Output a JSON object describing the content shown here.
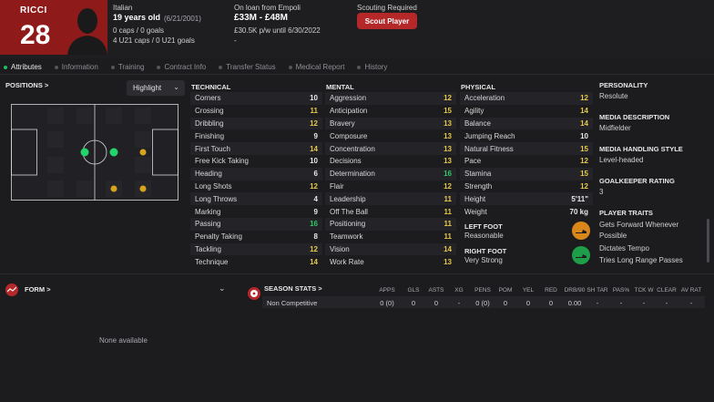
{
  "player": {
    "name": "RICCI",
    "number": "28",
    "nationality": "Italian",
    "age": "19 years old",
    "dob": "(6/21/2001)",
    "caps": "0 caps / 0 goals",
    "u21": "4 U21 caps / 0 U21 goals",
    "loan": "On loan from Empoli",
    "value": "£33M - £48M",
    "wage": "£30.5K p/w until 6/30/2022",
    "dash": "-",
    "scouting": "Scouting Required",
    "scout_button": "Scout Player"
  },
  "tabs": [
    "Attributes",
    "Information",
    "Training",
    "Contract Info",
    "Transfer Status",
    "Medical Report",
    "History"
  ],
  "positions": {
    "title": "POSITIONS >",
    "highlight": "Highlight"
  },
  "technical": {
    "title": "TECHNICAL",
    "rows": [
      {
        "n": "Corners",
        "v": "10",
        "c": ""
      },
      {
        "n": "Crossing",
        "v": "11",
        "c": "y"
      },
      {
        "n": "Dribbling",
        "v": "12",
        "c": "y"
      },
      {
        "n": "Finishing",
        "v": "9",
        "c": ""
      },
      {
        "n": "First Touch",
        "v": "14",
        "c": "y"
      },
      {
        "n": "Free Kick Taking",
        "v": "10",
        "c": ""
      },
      {
        "n": "Heading",
        "v": "6",
        "c": ""
      },
      {
        "n": "Long Shots",
        "v": "12",
        "c": "y"
      },
      {
        "n": "Long Throws",
        "v": "4",
        "c": ""
      },
      {
        "n": "Marking",
        "v": "9",
        "c": ""
      },
      {
        "n": "Passing",
        "v": "16",
        "c": "g"
      },
      {
        "n": "Penalty Taking",
        "v": "8",
        "c": ""
      },
      {
        "n": "Tackling",
        "v": "12",
        "c": "y"
      },
      {
        "n": "Technique",
        "v": "14",
        "c": "y"
      }
    ]
  },
  "mental": {
    "title": "MENTAL",
    "rows": [
      {
        "n": "Aggression",
        "v": "12",
        "c": "y"
      },
      {
        "n": "Anticipation",
        "v": "15",
        "c": "y"
      },
      {
        "n": "Bravery",
        "v": "13",
        "c": "y"
      },
      {
        "n": "Composure",
        "v": "13",
        "c": "y"
      },
      {
        "n": "Concentration",
        "v": "13",
        "c": "y"
      },
      {
        "n": "Decisions",
        "v": "13",
        "c": "y"
      },
      {
        "n": "Determination",
        "v": "16",
        "c": "g"
      },
      {
        "n": "Flair",
        "v": "12",
        "c": "y"
      },
      {
        "n": "Leadership",
        "v": "11",
        "c": "y"
      },
      {
        "n": "Off The Ball",
        "v": "11",
        "c": "y"
      },
      {
        "n": "Positioning",
        "v": "11",
        "c": "y"
      },
      {
        "n": "Teamwork",
        "v": "11",
        "c": "y"
      },
      {
        "n": "Vision",
        "v": "14",
        "c": "y"
      },
      {
        "n": "Work Rate",
        "v": "13",
        "c": "y"
      }
    ]
  },
  "physical": {
    "title": "PHYSICAL",
    "rows": [
      {
        "n": "Acceleration",
        "v": "12",
        "c": "y"
      },
      {
        "n": "Agility",
        "v": "14",
        "c": "y"
      },
      {
        "n": "Balance",
        "v": "14",
        "c": "y"
      },
      {
        "n": "Jumping Reach",
        "v": "10",
        "c": ""
      },
      {
        "n": "Natural Fitness",
        "v": "15",
        "c": "y"
      },
      {
        "n": "Pace",
        "v": "12",
        "c": "y"
      },
      {
        "n": "Stamina",
        "v": "15",
        "c": "y"
      },
      {
        "n": "Strength",
        "v": "12",
        "c": "y"
      },
      {
        "n": "Height",
        "v": "5'11\"",
        "c": ""
      },
      {
        "n": "Weight",
        "v": "70 kg",
        "c": ""
      }
    ],
    "left_foot_label": "LEFT FOOT",
    "left_foot_value": "Reasonable",
    "right_foot_label": "RIGHT FOOT",
    "right_foot_value": "Very Strong",
    "left_boot_color": "#d9861a",
    "right_boot_color": "#1e9e48"
  },
  "info": {
    "personality_label": "PERSONALITY",
    "personality": "Resolute",
    "media_desc_label": "MEDIA DESCRIPTION",
    "media_desc": "Midfielder",
    "media_style_label": "MEDIA HANDLING STYLE",
    "media_style": "Level-headed",
    "gk_label": "GOALKEEPER RATING",
    "gk": "3",
    "traits_label": "PLAYER TRAITS",
    "trait1a": "Gets Forward Whenever",
    "trait1b": "Possible",
    "trait2": "Dictates Tempo",
    "trait3": "Tries Long Range Passes"
  },
  "form": {
    "title": "FORM >",
    "empty": "None available"
  },
  "season": {
    "title": "SEASON STATS >",
    "headers": [
      "APPS",
      "GLS",
      "ASTS",
      "XG",
      "PENS",
      "POM",
      "YEL",
      "RED",
      "DRB/90",
      "SH TAR",
      "PAS%",
      "TCK W",
      "CLEAR",
      "AV RAT"
    ],
    "row_label": "Non Competitive",
    "row": [
      "0 (0)",
      "0",
      "0",
      "-",
      "0 (0)",
      "0",
      "0",
      "0",
      "0.00",
      "-",
      "-",
      "-",
      "-",
      "-"
    ]
  },
  "colors": {
    "accent": "#8e1a1a",
    "green": "#2fc86a",
    "yellow": "#e6c94a"
  }
}
